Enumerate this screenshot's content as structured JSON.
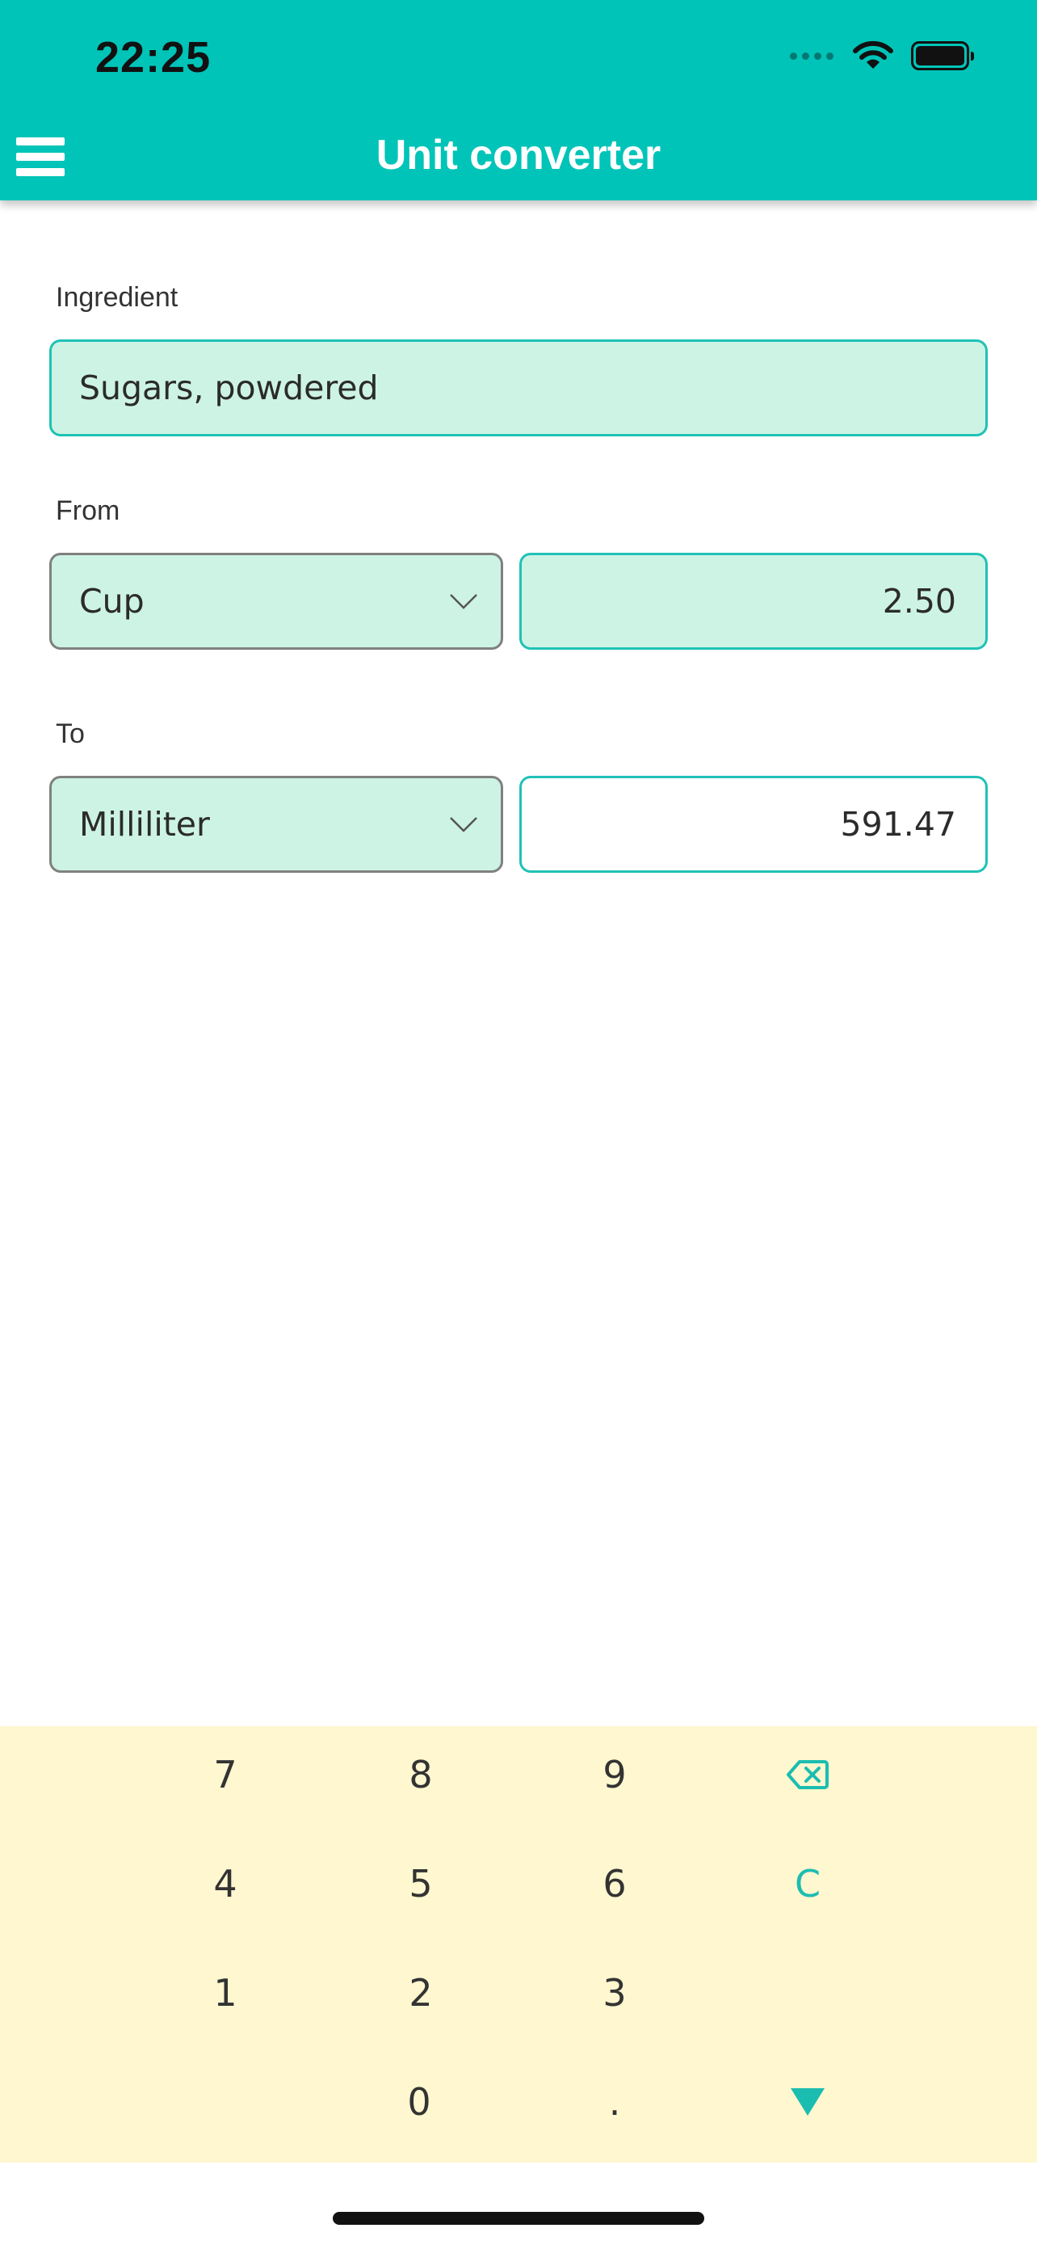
{
  "status_bar": {
    "time": "22:25"
  },
  "header": {
    "title": "Unit converter",
    "menu_icon": "hamburger-menu-icon"
  },
  "form": {
    "ingredient_label": "Ingredient",
    "ingredient_value": "Sugars, powdered",
    "from_label": "From",
    "from_unit": "Cup",
    "from_amount": "2.50",
    "to_label": "To",
    "to_unit": "Milliliter",
    "to_amount": "591.47"
  },
  "keypad": {
    "keys": [
      "7",
      "8",
      "9",
      "4",
      "5",
      "6",
      "C",
      "1",
      "2",
      "3",
      "0",
      "."
    ],
    "backspace_icon": "backspace-icon",
    "dismiss_icon": "triangle-down-icon"
  },
  "colors": {
    "accent": "#00c4b8",
    "field_fill": "#cdf3e4",
    "keypad_bg": "#fef7cf"
  }
}
